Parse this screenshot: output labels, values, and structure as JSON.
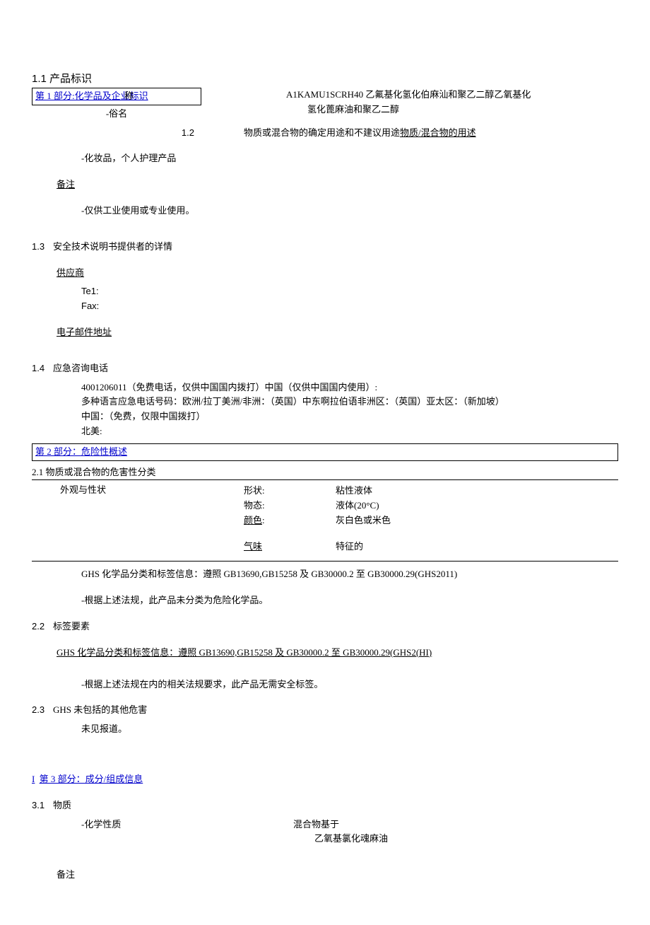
{
  "s1": {
    "num_title": "1.1 产品标识",
    "box": "第 1 部分:化学品及企业标识",
    "overlay_word": "称",
    "subname_label": "-俗名",
    "code": "A1KAMU1SCRH40 乙氟基化氢化伯麻汕和聚乙二醇乙氧基化",
    "code_line2": "氢化蓖麻油和聚乙二醇",
    "s1_2_num": "1.2",
    "s1_2_text_a": "物质或混合物的确定用途和不建议用途",
    "s1_2_text_b": "物质/混合物的用述",
    "use": "-化妆品，个人护理产品",
    "note_label": "备注",
    "note_text": "-仅供工业使用或专业使用。",
    "s1_3_num": "1.3",
    "s1_3_title": "安全技术说明书提供者的详情",
    "supplier": "供应商",
    "tel": "Te1:",
    "fax": "Fax:",
    "email": "电子邮件地址",
    "s1_4_num": "1.4",
    "s1_4_title": "应急咨询电话",
    "phone_line1": "4001206011（免费电话，仅供中国国内拨打）中国（仅供中国国内使用）:",
    "phone_line2": "多种语言应急电话号码：欧洲/拉丁美洲/非洲：（英国）中东啊拉伯语非洲区：（英国）亚太区：（新加坡）",
    "phone_line3": "中国：（免费，仅限中国拨打）",
    "phone_line4": "北美:"
  },
  "s2": {
    "box": "第 2 部分：危险性概述",
    "s2_1": "2.1 物质或混合物的危害性分类",
    "appearance_label": "外观与性状",
    "props": {
      "shape_label": "形状:",
      "shape_value": "粘性液体",
      "state_label": "物态:",
      "state_value": "液体(20°C)",
      "color_label": "颜色",
      "color_colon": ":",
      "color_value": "灰白色或米色",
      "odor_label": "气味",
      "odor_value": "特征的"
    },
    "ghs_info": "GHS 化学品分类和标签信息：遵照 GB13690,GB15258 及 GB30000.2 至 GB30000.29(GHS2011)",
    "ghs_note": "-根据上述法规，此产品未分类为危险化学品。",
    "s2_2_num": "2.2",
    "s2_2_title": "标签要素",
    "s2_2_ghs": "GHS 化学品分类和标签信息：遵照 GB13690,GB15258 及 GB30000.2 至 GB30000.29(GHS2(HI)",
    "s2_2_note": "-根据上述法规在内的相关法规要求，此产品无需安全标签。",
    "s2_3_num": "2.3",
    "s2_3_title": "GHS 未包括的其他危害",
    "s2_3_note": "未见报道。"
  },
  "s3": {
    "prefix": "I",
    "box": "第 3 部分：成分/组成信息",
    "s3_1_num": "3.1",
    "s3_1_title": "物质",
    "chem_label": "-化学性质",
    "chem_val1": "混合物基于",
    "chem_val2": "乙氧基氯化魂麻油",
    "note": "备注"
  }
}
